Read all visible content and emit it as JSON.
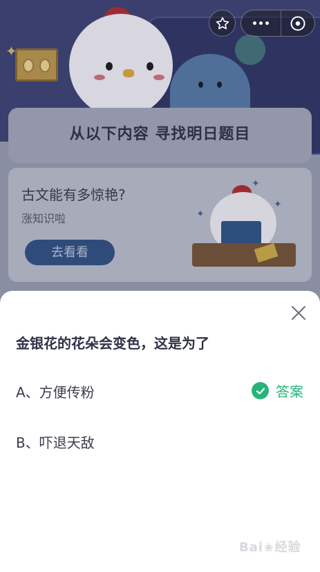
{
  "background_page": {
    "banner_title": "从以下内容 寻找明日题目",
    "card": {
      "title": "古文能有多惊艳?",
      "subtitle": "涨知识啦",
      "button_label": "去看看"
    }
  },
  "top_controls": {
    "icons": [
      "star-icon",
      "more-dots-icon",
      "close-circle-icon"
    ]
  },
  "quiz_sheet": {
    "question": "金银花的花朵会变色，这是为了",
    "options": [
      {
        "label": "A、方便传粉",
        "is_answer": true
      },
      {
        "label": "B、吓退天敌",
        "is_answer": false
      }
    ],
    "answer_label": "答案",
    "answer_color": "#27b47a"
  },
  "watermark": {
    "prefix": "Bai",
    "suffix": "经验"
  }
}
